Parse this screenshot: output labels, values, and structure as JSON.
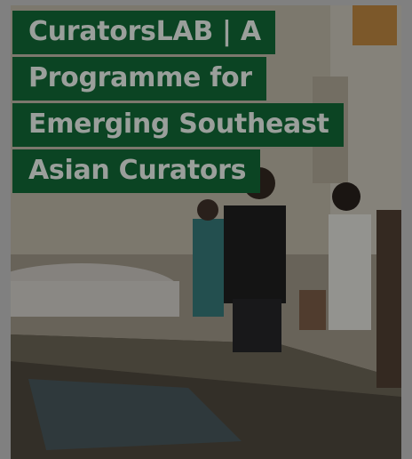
{
  "card": {
    "title": "CuratorsLAB | A Programme for Emerging Southeast Asian Curators"
  },
  "colors": {
    "title_background": "#0b4423",
    "title_text": "#9a9f9b",
    "overlay": "rgba(20,20,20,0.42)"
  }
}
